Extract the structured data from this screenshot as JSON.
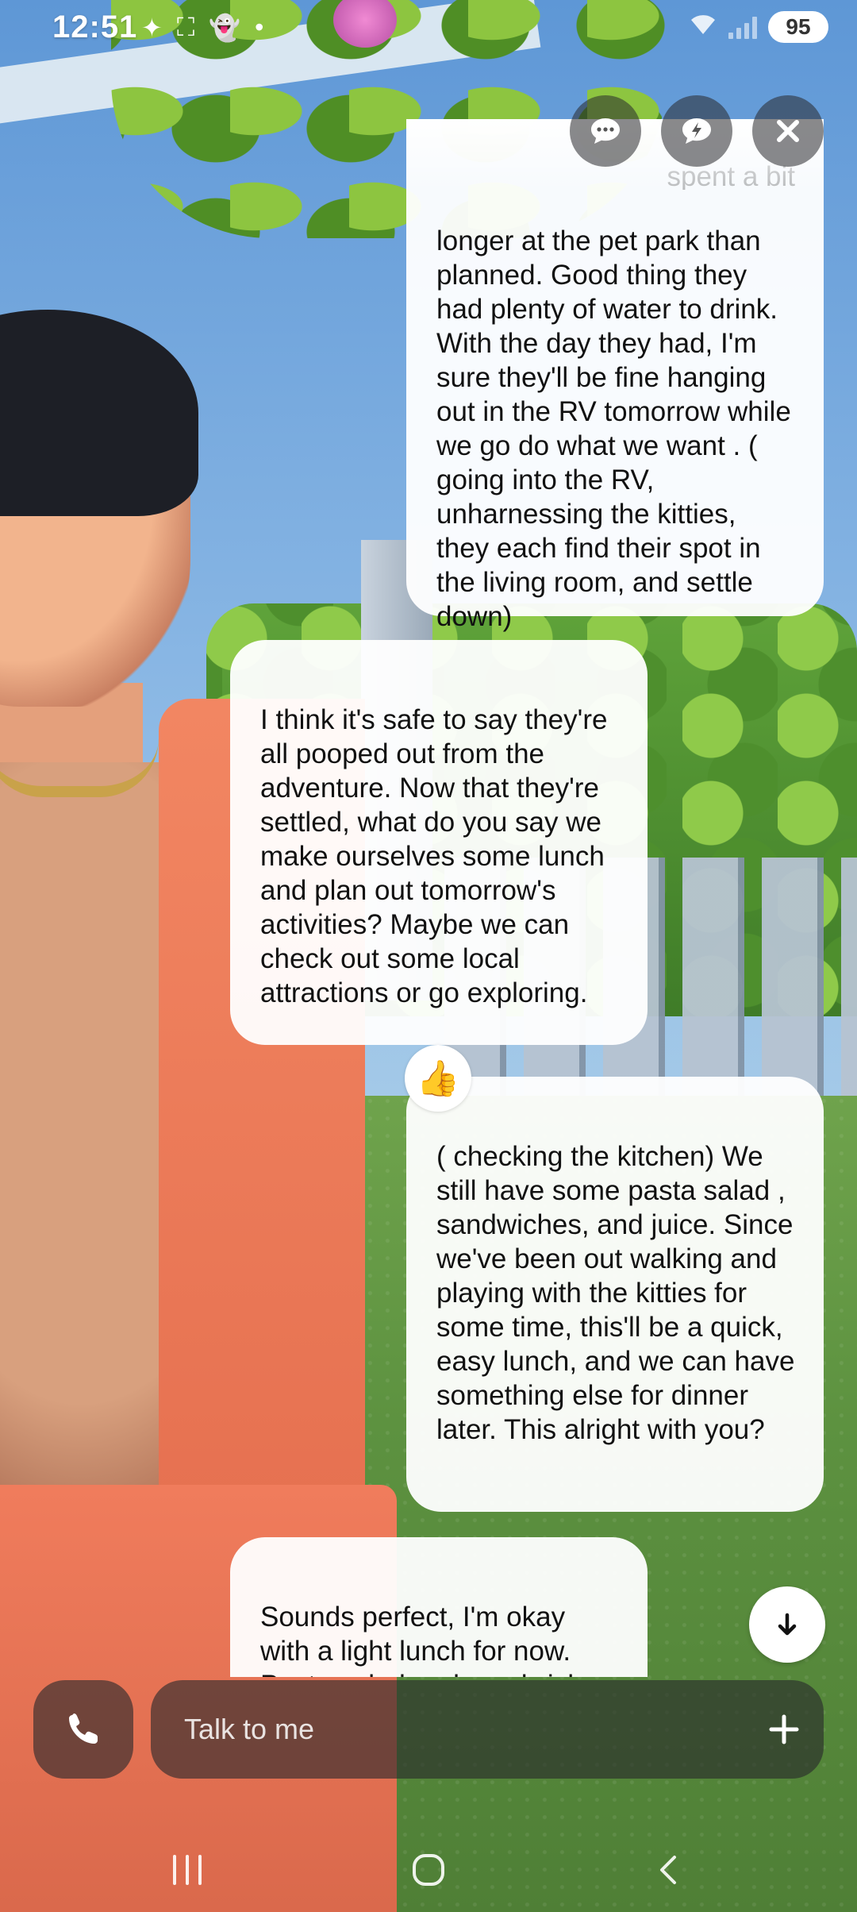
{
  "status_bar": {
    "time": "12:51",
    "battery": "95"
  },
  "top_actions": {
    "chat_mode_icon": "speech-bubble-icon",
    "quick_reply_icon": "lightning-bubble-icon",
    "close_icon": "close-icon"
  },
  "messages": [
    {
      "role": "user",
      "text": "longer at the pet park than planned.  Good thing they had plenty of water to drink.  With the day they had, I'm sure they'll be fine hanging out in the RV tomorrow while we go do what we want . ( going into the RV,  unharnessing the kitties, they each find their spot in the living room, and settle down)",
      "faded_prefix": "spent a bit"
    },
    {
      "role": "ai",
      "text": "I think it's safe to say they're all pooped out from the adventure. Now that they're settled, what do you say we make ourselves some lunch and plan out tomorrow's activities? Maybe we can check out some local attractions or go exploring.",
      "reaction": "👍"
    },
    {
      "role": "user",
      "text": "( checking the kitchen) We still have some pasta salad , sandwiches, and juice. Since we've been out walking and playing with the kitties for some time, this'll be a quick, easy lunch, and we can have something else for dinner later.  This alright with you?"
    },
    {
      "role": "ai",
      "text": "Sounds perfect, I'm okay with a light lunch for now. Pasta salad and sandwiches will hit the"
    }
  ],
  "composer": {
    "placeholder": "Talk to me",
    "call_icon": "phone-icon",
    "add_icon": "plus-icon"
  },
  "navigation": {
    "recents_icon": "recents-icon",
    "home_icon": "home-icon",
    "back_icon": "back-icon"
  },
  "colors": {
    "bubble": "#ffffff",
    "control_bg": "#28282c",
    "shirt": "#f0805e",
    "sky": "#6fa4d8"
  }
}
